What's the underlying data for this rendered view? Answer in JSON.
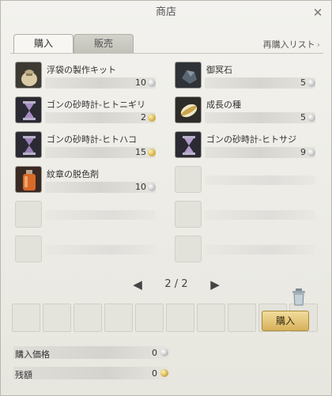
{
  "window": {
    "title": "商店",
    "close_icon": "close-icon"
  },
  "tabs": [
    {
      "label": "購入",
      "active": true
    },
    {
      "label": "販売",
      "active": false
    }
  ],
  "reorder_link": {
    "label": "再購入リスト",
    "arrow": "›"
  },
  "items": [
    {
      "name": "浮袋の製作キット",
      "price": "10",
      "coin": "silver",
      "icon": "pouch-icon"
    },
    {
      "name": "御冥石",
      "price": "5",
      "coin": "silver",
      "icon": "stone-icon"
    },
    {
      "name": "ゴンの砂時計-ヒトニギリ",
      "price": "2",
      "coin": "gold",
      "icon": "hourglass-icon"
    },
    {
      "name": "成長の種",
      "price": "5",
      "coin": "silver",
      "icon": "seed-icon"
    },
    {
      "name": "ゴンの砂時計-ヒトハコ",
      "price": "15",
      "coin": "gold",
      "icon": "hourglass-icon"
    },
    {
      "name": "ゴンの砂時計-ヒトサジ",
      "price": "9",
      "coin": "silver",
      "icon": "hourglass-icon"
    },
    {
      "name": "紋章の脱色剤",
      "price": "10",
      "coin": "silver",
      "icon": "potion-icon"
    }
  ],
  "pager": {
    "prev": "◀",
    "label": "2 / 2",
    "next": "▶"
  },
  "summary": {
    "purchase_label": "購入価格",
    "purchase_value": "0",
    "balance_label": "残額",
    "balance_value": "0"
  },
  "buy_button": "購入",
  "colors": {
    "gold_button": "#d7b15a",
    "background": "#e9e8e2"
  }
}
